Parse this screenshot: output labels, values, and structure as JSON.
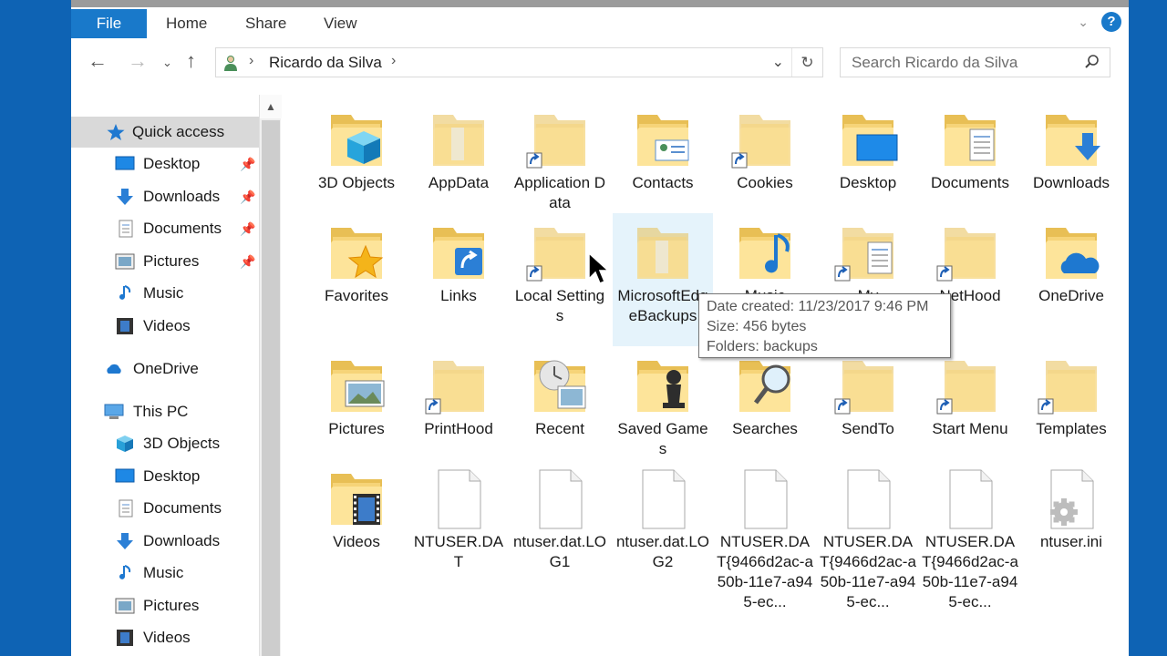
{
  "ribbon": {
    "tabs": [
      "File",
      "Home",
      "Share",
      "View"
    ]
  },
  "address": {
    "path": "Ricardo da Silva",
    "search_placeholder": "Search Ricardo da Silva"
  },
  "nav": {
    "quick_access": "Quick access",
    "quick_items": [
      "Desktop",
      "Downloads",
      "Documents",
      "Pictures",
      "Music",
      "Videos"
    ],
    "onedrive": "OneDrive",
    "this_pc": "This PC",
    "pc_items": [
      "3D Objects",
      "Desktop",
      "Documents",
      "Downloads",
      "Music",
      "Pictures",
      "Videos"
    ]
  },
  "items": [
    {
      "label": "3D Objects",
      "icon": "folder-3d-objects-icon"
    },
    {
      "label": "AppData",
      "icon": "folder-hidden-icon"
    },
    {
      "label": "Application Data",
      "icon": "folder-shortcut-icon"
    },
    {
      "label": "Contacts",
      "icon": "folder-contacts-icon"
    },
    {
      "label": "Cookies",
      "icon": "folder-shortcut-icon"
    },
    {
      "label": "Desktop",
      "icon": "folder-desktop-icon"
    },
    {
      "label": "Documents",
      "icon": "folder-documents-icon"
    },
    {
      "label": "Downloads",
      "icon": "folder-downloads-icon"
    },
    {
      "label": "Favorites",
      "icon": "folder-favorites-icon"
    },
    {
      "label": "Links",
      "icon": "folder-links-icon"
    },
    {
      "label": "Local Settings",
      "icon": "folder-shortcut-icon"
    },
    {
      "label": "MicrosoftEdgeBackups",
      "icon": "folder-hidden-icon"
    },
    {
      "label": "Music",
      "icon": "folder-music-icon"
    },
    {
      "label": "My",
      "icon": "folder-shortcut-documents-icon"
    },
    {
      "label": "NetHood",
      "icon": "folder-shortcut-icon"
    },
    {
      "label": "OneDrive",
      "icon": "folder-onedrive-icon"
    },
    {
      "label": "Pictures",
      "icon": "folder-pictures-icon"
    },
    {
      "label": "PrintHood",
      "icon": "folder-shortcut-icon"
    },
    {
      "label": "Recent",
      "icon": "folder-recent-icon"
    },
    {
      "label": "Saved Games",
      "icon": "folder-saved-games-icon"
    },
    {
      "label": "Searches",
      "icon": "folder-searches-icon"
    },
    {
      "label": "SendTo",
      "icon": "folder-shortcut-icon"
    },
    {
      "label": "Start Menu",
      "icon": "folder-shortcut-icon"
    },
    {
      "label": "Templates",
      "icon": "folder-shortcut-icon"
    },
    {
      "label": "Videos",
      "icon": "folder-videos-icon"
    },
    {
      "label": "NTUSER.DAT",
      "icon": "file-icon"
    },
    {
      "label": "ntuser.dat.LOG1",
      "icon": "file-icon"
    },
    {
      "label": "ntuser.dat.LOG2",
      "icon": "file-icon"
    },
    {
      "label": "NTUSER.DAT{9466d2ac-a50b-11e7-a945-ec...",
      "icon": "file-icon"
    },
    {
      "label": "NTUSER.DAT{9466d2ac-a50b-11e7-a945-ec...",
      "icon": "file-icon"
    },
    {
      "label": "NTUSER.DAT{9466d2ac-a50b-11e7-a945-ec...",
      "icon": "file-icon"
    },
    {
      "label": "ntuser.ini",
      "icon": "settings-file-icon"
    }
  ],
  "tooltip": {
    "date_created": "Date created: 11/23/2017 9:46 PM",
    "size": "Size: 456 bytes",
    "folders": "Folders: backups"
  }
}
